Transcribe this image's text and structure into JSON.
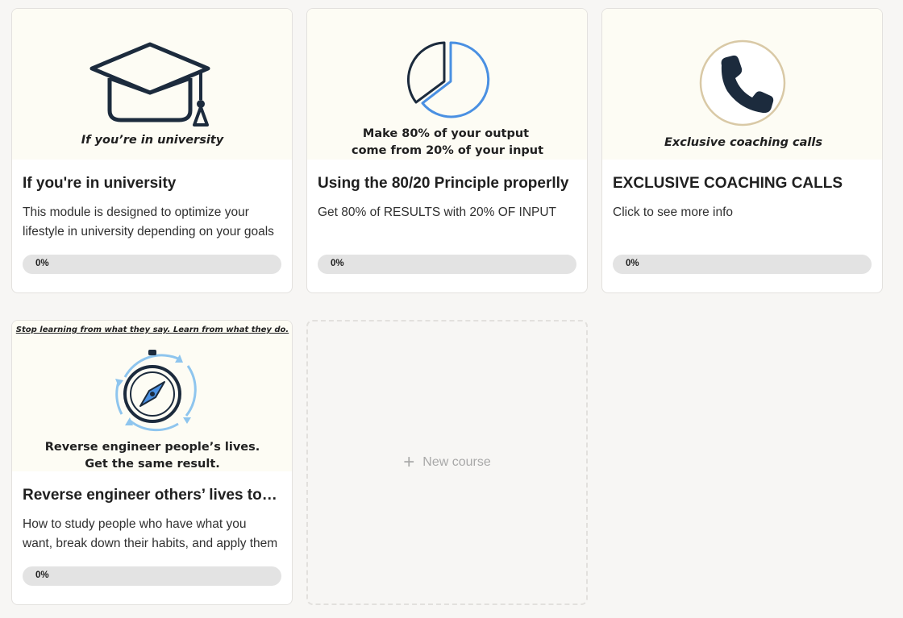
{
  "courses": [
    {
      "image_caption": "If you’re in university",
      "title": "If you're in university",
      "description_line1": "This module is designed to optimize your",
      "description_line2": "lifestyle in university depending on your goals",
      "progress_percent": 0,
      "progress_label": "0%"
    },
    {
      "image_caption_line1": "Make 80% of your output",
      "image_caption_line2": "come from 20% of your input",
      "title": "Using the 80/20 Principle properlly",
      "description_line1": "Get 80% of RESULTS with 20% OF INPUT",
      "description_line2": "",
      "progress_percent": 0,
      "progress_label": "0%"
    },
    {
      "image_caption": "Exclusive coaching calls",
      "title": "EXCLUSIVE COACHING CALLS",
      "description_line1": "Click to see more info",
      "description_line2": "",
      "progress_percent": 0,
      "progress_label": "0%"
    },
    {
      "image_header": "Stop learning from what they say. Learn from what they do.",
      "image_caption_line1": "Reverse engineer people’s lives.",
      "image_caption_line2": "Get the same result.",
      "title": "Reverse engineer others’ lives to get the same results",
      "description_line1": "How to study people who have what you",
      "description_line2": "want, break down their habits, and apply them",
      "progress_percent": 0,
      "progress_label": "0%"
    }
  ],
  "new_course": {
    "label": "New course",
    "icon": "plus-icon"
  },
  "colors": {
    "background": "#f7f6f4",
    "card": "#ffffff",
    "thumb_bg": "#fdfcf4",
    "navy": "#1c2b3d",
    "accent_blue": "#4a90e2",
    "progress_track": "#e3e3e3"
  }
}
